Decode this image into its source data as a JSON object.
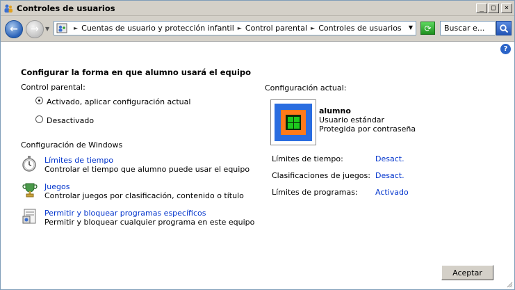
{
  "window": {
    "title": "Controles de usuarios",
    "minimize": "_",
    "maximize": "□",
    "close": "×"
  },
  "nav": {
    "breadcrumbs": [
      "Cuentas de usuario y protección infantil",
      "Control parental",
      "Controles de usuarios"
    ],
    "search_placeholder": "Buscar e..."
  },
  "main": {
    "title": "Configurar la forma en que alumno usará el equipo",
    "parental_label": "Control parental:",
    "options": [
      {
        "label": "Activado, aplicar configuración actual",
        "selected": true
      },
      {
        "label": "Desactivado",
        "selected": false
      }
    ],
    "windows_settings_label": "Configuración de Windows",
    "tasks": [
      {
        "title": "Límites de tiempo",
        "desc": "Controlar el tiempo que alumno puede usar el equipo",
        "icon": "stopwatch-icon"
      },
      {
        "title": "Juegos",
        "desc": "Controlar juegos por clasificación, contenido o título",
        "icon": "trophy-icon"
      },
      {
        "title": "Permitir y bloquear programas específicos",
        "desc": "Permitir y bloquear cualquier programa en este equipo",
        "icon": "program-icon"
      }
    ]
  },
  "current": {
    "label": "Configuración actual:",
    "user_name": "alumno",
    "user_type": "Usuario estándar",
    "user_protect": "Protegida por contraseña",
    "rows": [
      {
        "label": "Límites de tiempo:",
        "value": "Desact."
      },
      {
        "label": "Clasificaciones de juegos:",
        "value": "Desact."
      },
      {
        "label": "Límites de programas:",
        "value": "Activado"
      }
    ]
  },
  "buttons": {
    "ok": "Aceptar"
  },
  "colors": {
    "link": "#0033cc",
    "chrome": "#d4d0c8"
  }
}
